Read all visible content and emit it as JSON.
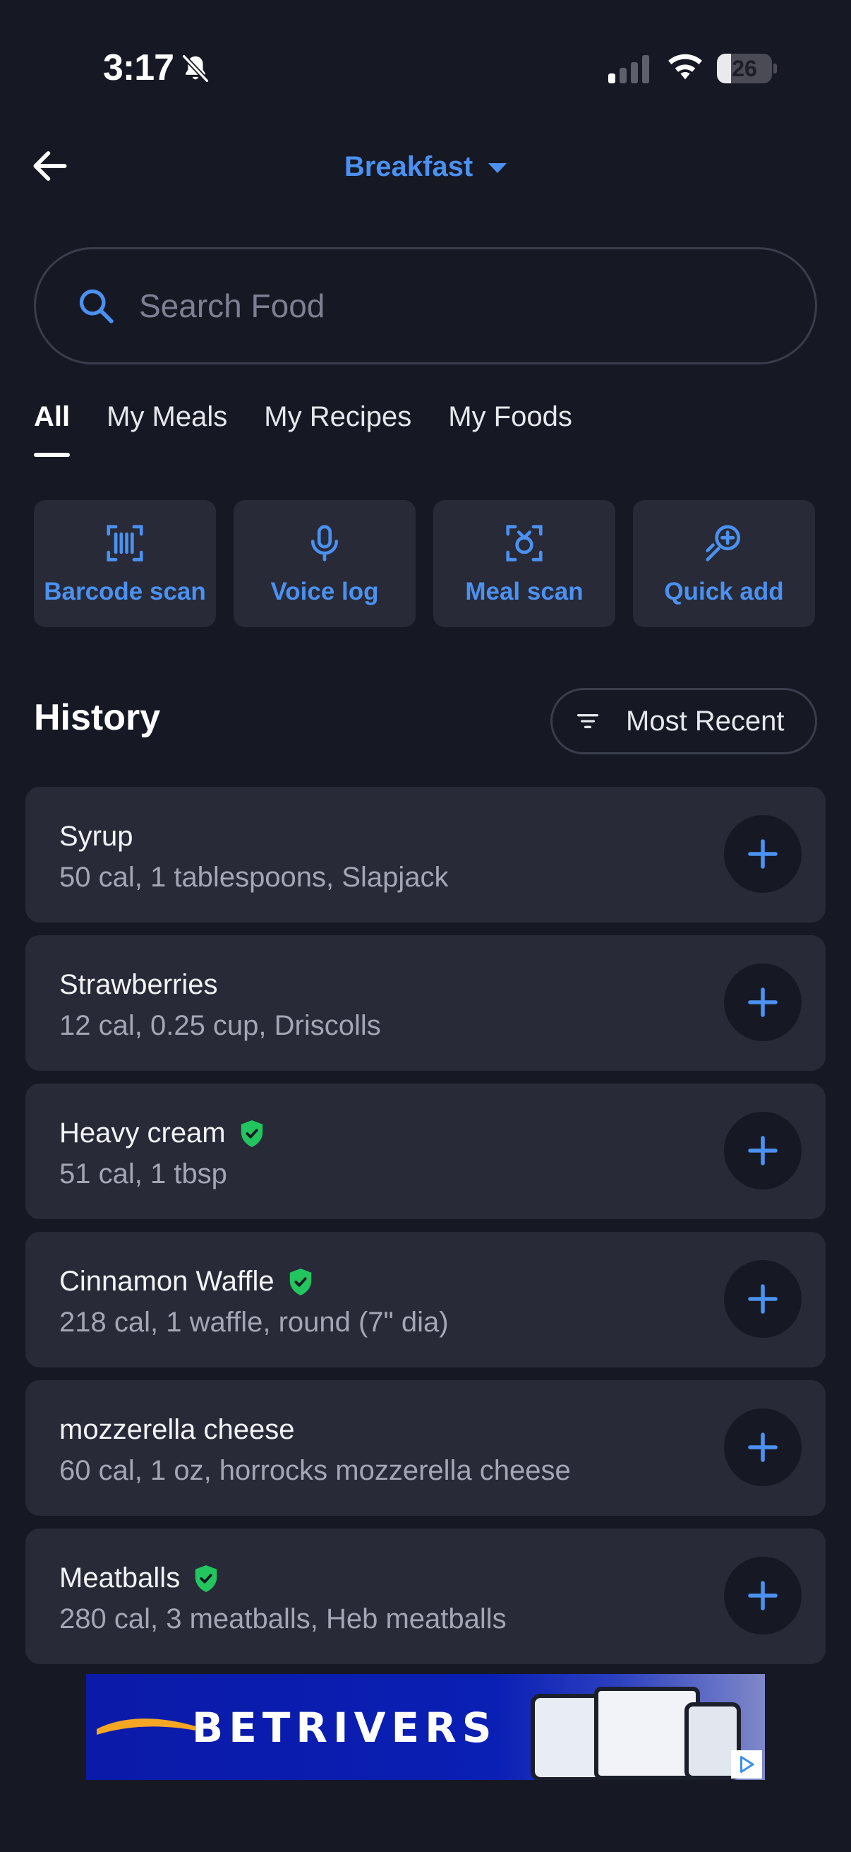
{
  "status_bar": {
    "time": "3:17",
    "battery": "26",
    "battery_level_percent": 26,
    "icons": [
      "bell-slash-icon",
      "cellular-signal-icon",
      "wifi-icon",
      "battery-icon"
    ]
  },
  "header": {
    "meal": "Breakfast",
    "back_icon": "arrow-left-icon",
    "dropdown_icon": "caret-down-icon"
  },
  "search": {
    "placeholder": "Search Food",
    "value": "",
    "icon": "search-icon"
  },
  "tabs": [
    {
      "label": "All",
      "active": true
    },
    {
      "label": "My Meals",
      "active": false
    },
    {
      "label": "My Recipes",
      "active": false
    },
    {
      "label": "My Foods",
      "active": false
    }
  ],
  "quick_actions": [
    {
      "label": "Barcode scan",
      "icon": "barcode-scan-icon"
    },
    {
      "label": "Voice log",
      "icon": "microphone-icon"
    },
    {
      "label": "Meal scan",
      "icon": "camera-scan-icon"
    },
    {
      "label": "Quick add",
      "icon": "quick-add-icon"
    }
  ],
  "history": {
    "title": "History",
    "sort_label": "Most Recent",
    "sort_icon": "filter-icon",
    "items": [
      {
        "name": "Syrup",
        "detail": "50 cal, 1 tablespoons, Slapjack",
        "verified": false
      },
      {
        "name": "Strawberries",
        "detail": "12 cal, 0.25 cup, Driscolls",
        "verified": false
      },
      {
        "name": "Heavy cream",
        "detail": "51 cal, 1 tbsp",
        "verified": true
      },
      {
        "name": "Cinnamon Waffle",
        "detail": "218 cal, 1 waffle, round (7\" dia)",
        "verified": true
      },
      {
        "name": "mozzerella cheese",
        "detail": "60 cal, 1 oz, horrocks mozzerella cheese",
        "verified": false
      },
      {
        "name": "Meatballs",
        "detail": "280 cal, 3 meatballs, Heb meatballs",
        "verified": true
      }
    ]
  },
  "ad": {
    "brand": "BETRIVERS"
  },
  "colors": {
    "background": "#161824",
    "card": "#282a37",
    "accent": "#4b91f1",
    "verified": "#22c55e"
  }
}
